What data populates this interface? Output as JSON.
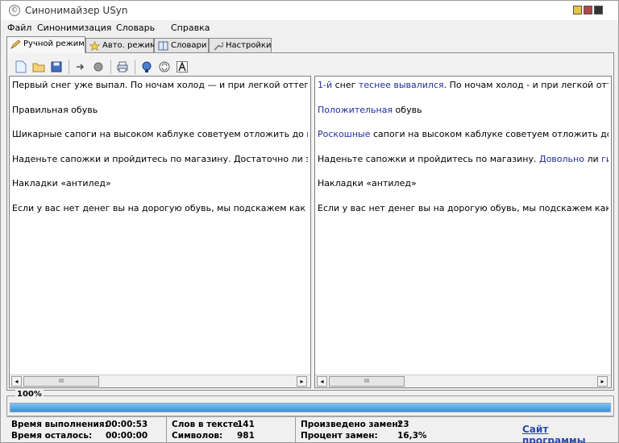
{
  "window": {
    "title": "Синонимайзер USyn",
    "icon_glyph": "©"
  },
  "menu": [
    "Файл",
    "Синонимизация",
    "Словарь",
    "Справка"
  ],
  "tabs": [
    {
      "label": "Ручной режим",
      "icon": "pencil-icon",
      "active": true
    },
    {
      "label": "Авто. режим",
      "icon": "star-icon",
      "active": false
    },
    {
      "label": "Словари",
      "icon": "book-icon",
      "active": false
    },
    {
      "label": "Настройки",
      "icon": "wrench-icon",
      "active": false
    }
  ],
  "toolbar": [
    "new-document-icon",
    "open-folder-icon",
    "save-icon",
    "forward-icon",
    "record-icon",
    "print-icon",
    "synonymize-icon",
    "swap-icon",
    "font-icon"
  ],
  "source_text": [
    "Первый снег уже выпал. По ночам холод — и при легкой оттепел",
    "Правильная обувь",
    "Шикарные сапоги на высоком каблуке советуем отложить до вес",
    "Наденьте сапожки и пройдитесь по магазину. Достаточно ли эла",
    "Накладки «антилед»",
    "Если у вас нет денег вы на дорогую обувь, мы подскажем как сде"
  ],
  "result_text": [
    [
      {
        "t": "1-й",
        "hl": true
      },
      {
        "t": " снег ",
        "hl": false
      },
      {
        "t": "теснее вывалился",
        "hl": true
      },
      {
        "t": ". По ночам холод - и при легкой отте",
        "hl": false
      }
    ],
    [
      {
        "t": "Положительная",
        "hl": true
      },
      {
        "t": " обувь",
        "hl": false
      }
    ],
    [
      {
        "t": "Роскошные",
        "hl": true
      },
      {
        "t": " сапоги на высоком каблуке советуем отложить до в",
        "hl": false
      }
    ],
    [
      {
        "t": "Наденьте сапожки и пройдитесь по магазину. ",
        "hl": false
      },
      {
        "t": "Довольно",
        "hl": true
      },
      {
        "t": " ли ",
        "hl": false
      },
      {
        "t": "гибк",
        "hl": true
      }
    ],
    [
      {
        "t": "Накладки «антилед»",
        "hl": false
      }
    ],
    [
      {
        "t": "Если у вас нет денег вы на дорогую обувь, мы подскажем как с",
        "hl": false
      }
    ]
  ],
  "scrollbar": {
    "thumb_label": "III",
    "left_arrow": "◂",
    "right_arrow": "▸"
  },
  "progress": {
    "label": "100%",
    "value": 1.0,
    "color": "#3a8fd8"
  },
  "status": {
    "exec_time_label": "Время выполнения:",
    "exec_time_value": "00:00:53",
    "remaining_label": "Время осталось:",
    "remaining_value": "00:00:00",
    "words_label": "Слов в тексте:",
    "words_value": "141",
    "chars_label": "Символов:",
    "chars_value": "981",
    "replacements_label": "Произведено замен:",
    "replacements_value": "23",
    "percent_label": "Процент замен:",
    "percent_value": "16,3%",
    "site_link": "Сайт программы"
  },
  "colors": {
    "highlight": "#1f2f9a",
    "link": "#2a4aa8"
  }
}
